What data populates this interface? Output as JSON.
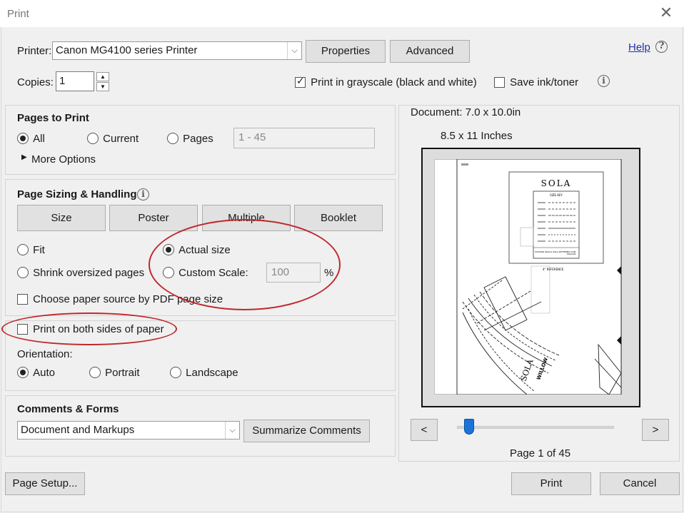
{
  "window": {
    "title": "Print",
    "close_icon": "close-icon"
  },
  "printer": {
    "label": "Printer:",
    "selected": "Canon MG4100 series Printer",
    "properties_label": "Properties",
    "advanced_label": "Advanced",
    "help_label": "Help"
  },
  "copies": {
    "label": "Copies:",
    "value": "1"
  },
  "grayscale": {
    "label": "Print in grayscale (black and white)",
    "checked": true
  },
  "save_ink": {
    "label": "Save ink/toner",
    "checked": false
  },
  "pages_to_print": {
    "heading": "Pages to Print",
    "all_label": "All",
    "current_label": "Current",
    "pages_label": "Pages",
    "pages_value": "1 - 45",
    "more_options_label": "More Options",
    "selected": "All"
  },
  "page_sizing": {
    "heading": "Page Sizing & Handling",
    "size_label": "Size",
    "poster_label": "Poster",
    "multiple_label": "Multiple",
    "booklet_label": "Booklet",
    "fit_label": "Fit",
    "actual_size_label": "Actual size",
    "shrink_label": "Shrink oversized pages",
    "custom_scale_label": "Custom Scale:",
    "custom_scale_value": "100",
    "percent_sign": "%",
    "choose_paper_label": "Choose paper source by PDF page size",
    "selected": "Actual size"
  },
  "duplex": {
    "label": "Print on both sides of paper",
    "checked": false
  },
  "orientation": {
    "label": "Orientation:",
    "auto_label": "Auto",
    "portrait_label": "Portrait",
    "landscape_label": "Landscape",
    "selected": "Auto"
  },
  "comments_forms": {
    "heading": "Comments & Forms",
    "selected": "Document and Markups",
    "summarize_label": "Summarize Comments"
  },
  "preview": {
    "document_size": "Document: 7.0 x 10.0in",
    "paper_size": "8.5 x 11 Inches",
    "prev_label": "<",
    "next_label": ">",
    "page_indicator": "Page 1 of 45",
    "slider_position": 1
  },
  "pattern": {
    "brand": "SOLA",
    "sub_brand": "WILLOW",
    "size_key": "SIZE KEY",
    "footer_left": "SCISSOR SKILLS SOLA.PATTERNS.COM",
    "footer_right": "WILLOW",
    "reference": "4\" REFERENCE"
  },
  "footer": {
    "page_setup_label": "Page Setup...",
    "print_label": "Print",
    "cancel_label": "Cancel"
  },
  "colors": {
    "annotation_red": "#c0282d",
    "slider_blue": "#1a73d8"
  }
}
